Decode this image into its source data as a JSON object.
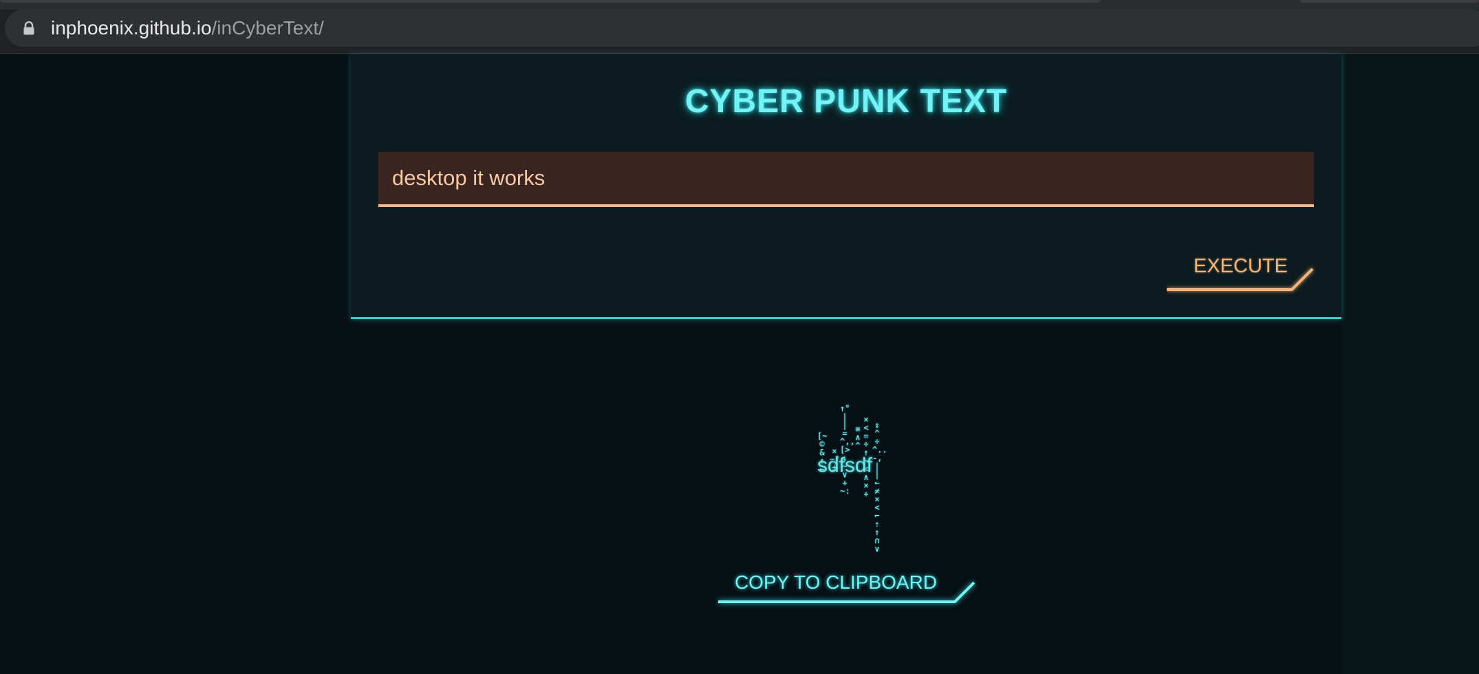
{
  "browser": {
    "url_domain": "inphoenix.github.io",
    "url_path": "/inCyberText/"
  },
  "app": {
    "title": "CYBER PUNK TEXT",
    "input_value": "desktop it works",
    "execute_label": "EXECUTE",
    "output_text": "sdfsdf",
    "copy_label": "COPY TO CLIPBOARD",
    "glyph_columns": [
      "[~©&↑←",
      "×~°±",
      "↑°||=^,,[>↓~∨+~:",
      "≡∧^",
      "×<=÷↑~<∧×+",
      "↕^÷^..-,||←≠×<⌐⇡↑∩∨"
    ]
  },
  "colors": {
    "accent_cyan": "#74f2f4",
    "accent_orange": "#f6b277",
    "panel_bg": "#0b1b1f",
    "input_bg": "#3b2520"
  }
}
